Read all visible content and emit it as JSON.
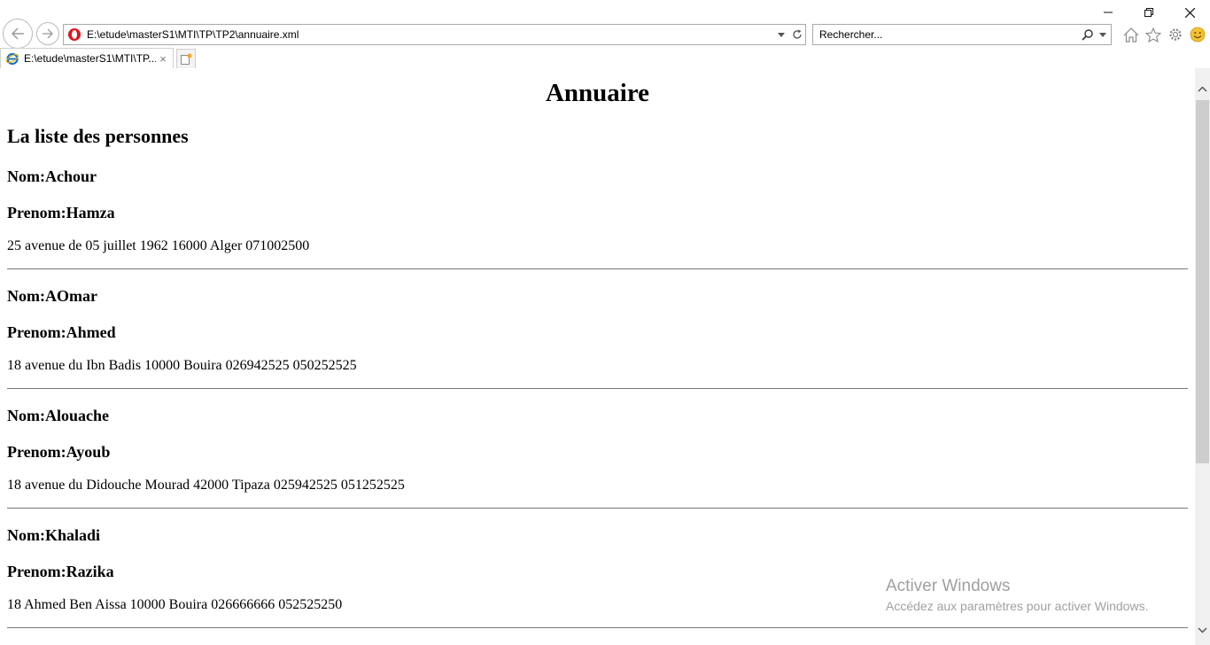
{
  "browser": {
    "address": "E:\\etude\\masterS1\\MTI\\TP\\TP2\\annuaire.xml",
    "search_placeholder": "Rechercher...",
    "tab_label": "E:\\etude\\masterS1\\MTI\\TP...",
    "tab_close": "×"
  },
  "page": {
    "title": "Annuaire",
    "list_title": "La liste des personnes",
    "persons": [
      {
        "nom": "Nom:Achour",
        "prenom": "Prenom:Hamza",
        "address": "25 avenue de 05 juillet 1962 16000 Alger 071002500"
      },
      {
        "nom": "Nom:AOmar",
        "prenom": "Prenom:Ahmed",
        "address": "18 avenue du Ibn Badis 10000 Bouira 026942525 050252525"
      },
      {
        "nom": "Nom:Alouache",
        "prenom": "Prenom:Ayoub",
        "address": "18 avenue du Didouche Mourad 42000 Tipaza 025942525 051252525"
      },
      {
        "nom": "Nom:Khaladi",
        "prenom": "Prenom:Razika",
        "address": "18 Ahmed Ben Aissa 10000 Bouira 026666666 052525250"
      }
    ]
  },
  "watermark": {
    "title": "Activer Windows",
    "subtitle": "Accédez aux paramètres pour activer Windows."
  },
  "colors": {
    "border": "#a9a9a9",
    "opera_red": "#e0161d",
    "ie_blue": "#1e73c6",
    "smiley": "#f2c230"
  }
}
